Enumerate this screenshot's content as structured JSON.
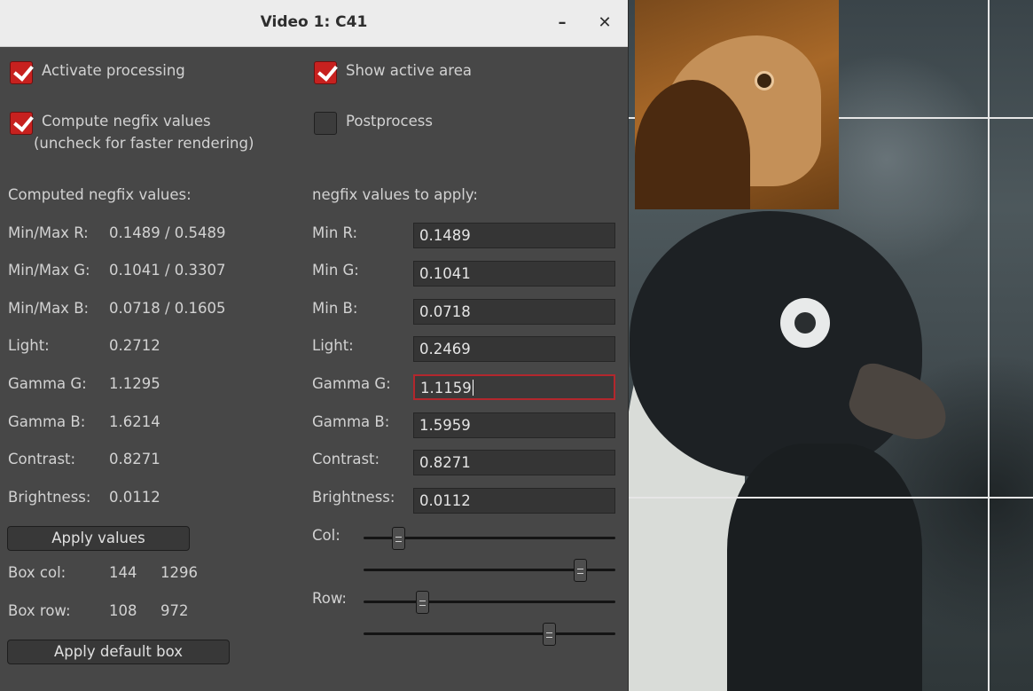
{
  "window": {
    "title": "Video 1: C41",
    "minimize_glyph": "–",
    "close_glyph": "✕"
  },
  "options": {
    "activate_processing": {
      "label": "Activate processing",
      "checked": true
    },
    "show_active_area": {
      "label": "Show active area",
      "checked": true
    },
    "compute_negfix": {
      "label": "Compute negfix values",
      "sublabel": "(uncheck for faster rendering)",
      "checked": true
    },
    "postprocess": {
      "label": "Postprocess",
      "checked": false
    }
  },
  "computed": {
    "heading": "Computed negfix values:",
    "rows": [
      {
        "label": "Min/Max R:",
        "value": "0.1489 / 0.5489"
      },
      {
        "label": "Min/Max G:",
        "value": "0.1041 / 0.3307"
      },
      {
        "label": "Min/Max B:",
        "value": "0.0718 / 0.1605"
      },
      {
        "label": "Light:",
        "value": "0.2712"
      },
      {
        "label": "Gamma G:",
        "value": "1.1295"
      },
      {
        "label": "Gamma B:",
        "value": "1.6214"
      },
      {
        "label": "Contrast:",
        "value": "0.8271"
      },
      {
        "label": "Brightness:",
        "value": "0.0112"
      }
    ],
    "apply_button": "Apply values",
    "box_col": {
      "label": "Box col:",
      "v1": "144",
      "v2": "1296"
    },
    "box_row": {
      "label": "Box row:",
      "v1": "108",
      "v2": "972"
    },
    "default_box_button": "Apply default box"
  },
  "apply": {
    "heading": "negfix values to apply:",
    "fields": [
      {
        "label": "Min R:",
        "value": "0.1489"
      },
      {
        "label": "Min G:",
        "value": "0.1041"
      },
      {
        "label": "Min B:",
        "value": "0.0718"
      },
      {
        "label": "Light:",
        "value": "0.2469"
      },
      {
        "label": "Gamma G:",
        "value": "1.1159"
      },
      {
        "label": "Gamma B:",
        "value": "1.5959"
      },
      {
        "label": "Contrast:",
        "value": "0.8271"
      },
      {
        "label": "Brightness:",
        "value": "0.0112"
      }
    ],
    "col_label": "Col:",
    "row_label": "Row:",
    "sliders": {
      "col_start": 0.12,
      "col_end": 0.88,
      "row_start": 0.22,
      "row_end": 0.75
    }
  },
  "colors": {
    "check_red": "#c7211f",
    "focus_border": "#b3272d",
    "panel": "#474747"
  }
}
